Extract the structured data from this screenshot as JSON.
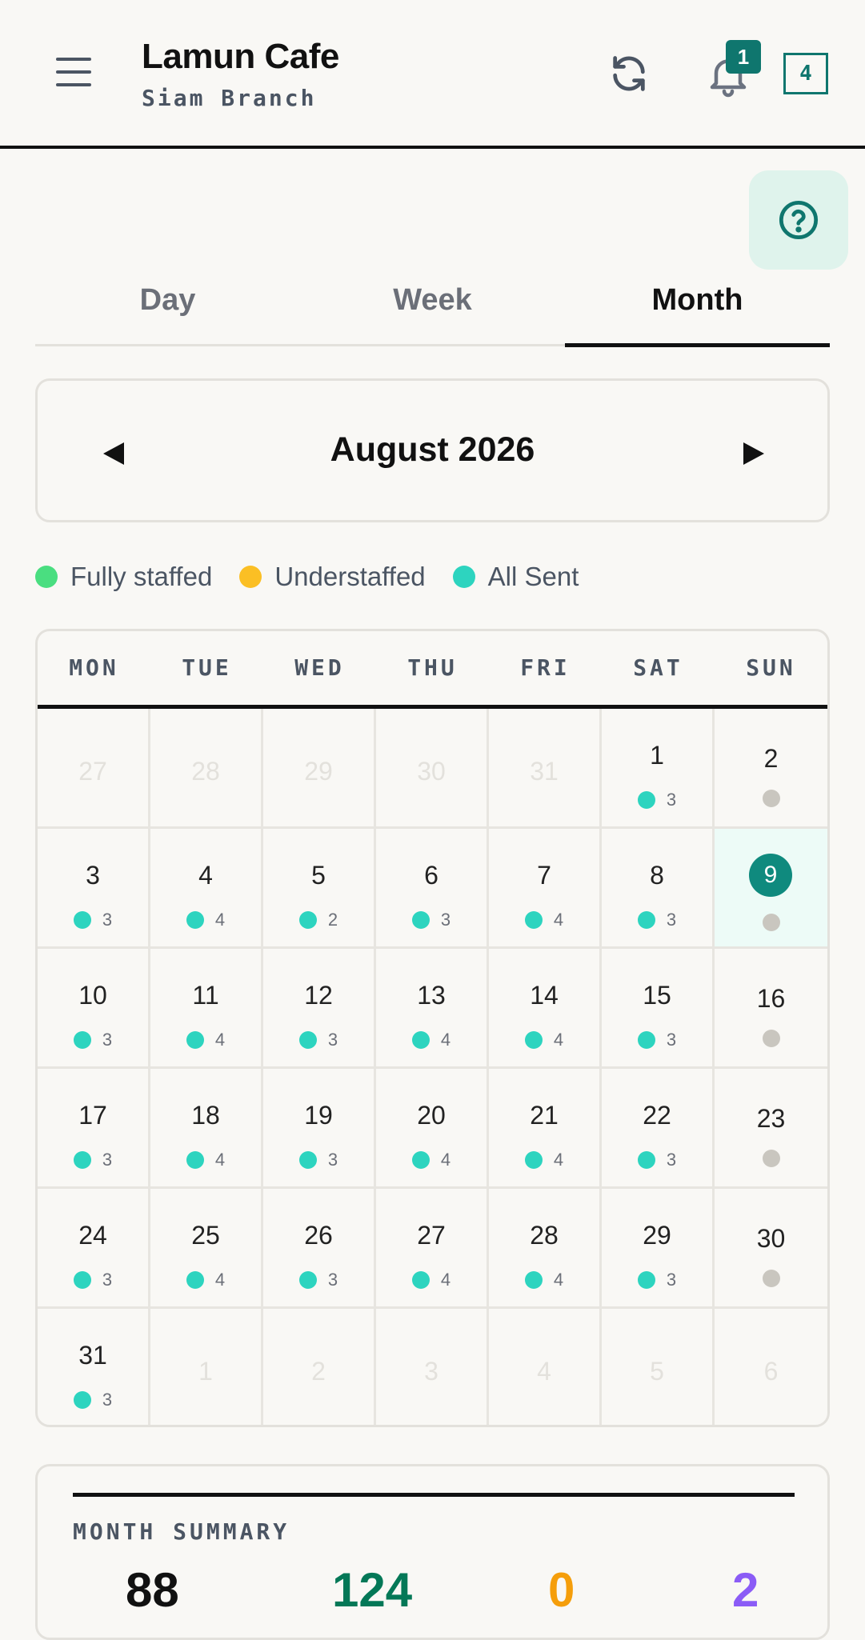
{
  "header": {
    "title": "Lamun Cafe",
    "subtitle": "Siam Branch",
    "notification_count": "1",
    "count_box": "4"
  },
  "tabs": [
    {
      "label": "Day",
      "active": false
    },
    {
      "label": "Week",
      "active": false
    },
    {
      "label": "Month",
      "active": true
    }
  ],
  "month_nav": {
    "label": "August 2026"
  },
  "legend": [
    {
      "label": "Fully staffed",
      "color": "#4ade80"
    },
    {
      "label": "Understaffed",
      "color": "#fbbf24"
    },
    {
      "label": "All Sent",
      "color": "#2dd4bf"
    }
  ],
  "calendar": {
    "weekdays": [
      "MON",
      "TUE",
      "WED",
      "THU",
      "FRI",
      "SAT",
      "SUN"
    ],
    "today": "9",
    "days": [
      {
        "day": "27",
        "outside": true
      },
      {
        "day": "28",
        "outside": true
      },
      {
        "day": "29",
        "outside": true
      },
      {
        "day": "30",
        "outside": true
      },
      {
        "day": "31",
        "outside": true
      },
      {
        "day": "1",
        "status": "sent",
        "count": "3"
      },
      {
        "day": "2",
        "status": "off"
      },
      {
        "day": "3",
        "status": "sent",
        "count": "3"
      },
      {
        "day": "4",
        "status": "sent",
        "count": "4"
      },
      {
        "day": "5",
        "status": "sent",
        "count": "2"
      },
      {
        "day": "6",
        "status": "sent",
        "count": "3"
      },
      {
        "day": "7",
        "status": "sent",
        "count": "4"
      },
      {
        "day": "8",
        "status": "sent",
        "count": "3"
      },
      {
        "day": "9",
        "status": "off",
        "today": true
      },
      {
        "day": "10",
        "status": "sent",
        "count": "3"
      },
      {
        "day": "11",
        "status": "sent",
        "count": "4"
      },
      {
        "day": "12",
        "status": "sent",
        "count": "3"
      },
      {
        "day": "13",
        "status": "sent",
        "count": "4"
      },
      {
        "day": "14",
        "status": "sent",
        "count": "4"
      },
      {
        "day": "15",
        "status": "sent",
        "count": "3"
      },
      {
        "day": "16",
        "status": "off"
      },
      {
        "day": "17",
        "status": "sent",
        "count": "3"
      },
      {
        "day": "18",
        "status": "sent",
        "count": "4"
      },
      {
        "day": "19",
        "status": "sent",
        "count": "3"
      },
      {
        "day": "20",
        "status": "sent",
        "count": "4"
      },
      {
        "day": "21",
        "status": "sent",
        "count": "4"
      },
      {
        "day": "22",
        "status": "sent",
        "count": "3"
      },
      {
        "day": "23",
        "status": "off"
      },
      {
        "day": "24",
        "status": "sent",
        "count": "3"
      },
      {
        "day": "25",
        "status": "sent",
        "count": "4"
      },
      {
        "day": "26",
        "status": "sent",
        "count": "3"
      },
      {
        "day": "27",
        "status": "sent",
        "count": "4"
      },
      {
        "day": "28",
        "status": "sent",
        "count": "4"
      },
      {
        "day": "29",
        "status": "sent",
        "count": "3"
      },
      {
        "day": "30",
        "status": "off"
      },
      {
        "day": "31",
        "status": "sent",
        "count": "3"
      },
      {
        "day": "1",
        "outside": true
      },
      {
        "day": "2",
        "outside": true
      },
      {
        "day": "3",
        "outside": true
      },
      {
        "day": "4",
        "outside": true
      },
      {
        "day": "5",
        "outside": true
      },
      {
        "day": "6",
        "outside": true
      }
    ]
  },
  "summary": {
    "title": "MONTH SUMMARY",
    "stats": [
      {
        "value": "88",
        "color": "#111111"
      },
      {
        "value": "124",
        "color": "#047857"
      },
      {
        "value": "0",
        "color": "#f59e0b"
      },
      {
        "value": "2",
        "color": "#8b5cf6"
      }
    ]
  },
  "colors": {
    "accent": "#0f766e",
    "sent": "#2dd4bf",
    "off": "#c9c6bf",
    "today_bg": "#edfbf7"
  },
  "icons": {
    "menu": "menu-icon",
    "refresh": "refresh-icon",
    "bell": "bell-icon",
    "help": "help-icon",
    "prev": "triangle-left-icon",
    "next": "triangle-right-icon"
  }
}
